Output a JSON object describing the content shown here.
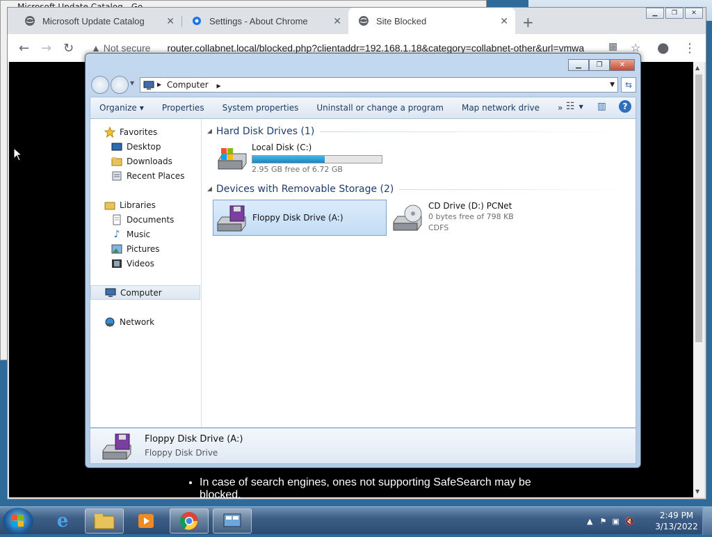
{
  "background": {
    "left_window_title": "Microsoft Update Catalog - Google Chrome"
  },
  "chrome": {
    "tabs": [
      {
        "label": "Microsoft Update Catalog",
        "icon": "globe-icon",
        "active": false
      },
      {
        "label": "Settings - About Chrome",
        "icon": "gear-icon",
        "active": false
      },
      {
        "label": "Site Blocked",
        "icon": "globe-icon",
        "active": true
      }
    ],
    "new_tab": "+",
    "security_label": "Not secure",
    "url": "router.collabnet.local/blocked.php?clientaddr=192.168.1.18&category=collabnet-other&url=vmwa",
    "page_bullet_1": "In case of search engines, ones not supporting SafeSearch may be blocked."
  },
  "explorer": {
    "address": "Computer",
    "commands": [
      "Organize",
      "Properties",
      "System properties",
      "Uninstall or change a program",
      "Map network drive"
    ],
    "more": "»",
    "nav": {
      "favorites": "Favorites",
      "desktop": "Desktop",
      "downloads": "Downloads",
      "recent": "Recent Places",
      "libraries": "Libraries",
      "documents": "Documents",
      "music": "Music",
      "pictures": "Pictures",
      "videos": "Videos",
      "computer": "Computer",
      "network": "Network"
    },
    "groups": {
      "hdd": "Hard Disk Drives (1)",
      "removable": "Devices with Removable Storage (2)"
    },
    "drives": {
      "c": {
        "name": "Local Disk (C:)",
        "space": "2.95 GB free of 6.72 GB",
        "used_fraction": 0.56
      },
      "a": {
        "name": "Floppy Disk Drive (A:)"
      },
      "d": {
        "name": "CD Drive (D:) PCNet",
        "space": "0 bytes free of 798 KB",
        "fs": "CDFS"
      }
    },
    "details": {
      "name": "Floppy Disk Drive (A:)",
      "type": "Floppy Disk Drive"
    }
  },
  "taskbar": {
    "time": "2:49 PM",
    "date": "3/13/2022"
  }
}
